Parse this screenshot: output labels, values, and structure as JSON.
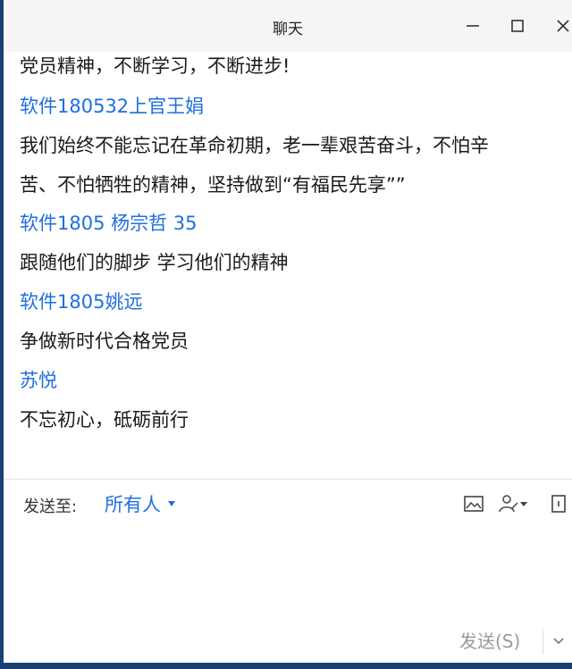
{
  "window": {
    "title": "聊天",
    "minimize_label": "—",
    "maximize_label": "□",
    "close_label": "✕"
  },
  "messages": [
    {
      "type": "text",
      "text": "党员精神，不断学习，不断进步!"
    },
    {
      "type": "sender",
      "text": "软件180532上官王娟"
    },
    {
      "type": "text",
      "text": "我们始终不能忘记在革命初期，老一辈艰苦奋斗，不怕辛"
    },
    {
      "type": "text",
      "text": "苦、不怕牺牲的精神，坚持做到“有福民先享””"
    },
    {
      "type": "sender",
      "text": "软件1805 杨宗哲 35"
    },
    {
      "type": "text",
      "text": "跟随他们的脚步 学习他们的精神"
    },
    {
      "type": "sender",
      "text": "软件1805姚远"
    },
    {
      "type": "text",
      "text": "争做新时代合格党员"
    },
    {
      "type": "sender",
      "text": "苏悦"
    },
    {
      "type": "text",
      "text": "不忘初心，砥砺前行"
    }
  ],
  "compose": {
    "sendto_label": "发送至:",
    "recipient": "所有人",
    "input_value": "",
    "send_label": "发送(S)"
  },
  "icons": {
    "image": "image-icon",
    "annotation": "annotation-icon",
    "exit": "exit-icon",
    "dropdown": "chevron-down-icon"
  },
  "colors": {
    "sender": "#1f6fe0",
    "text": "#1a1a1a",
    "send_disabled": "#9a9a9a"
  }
}
